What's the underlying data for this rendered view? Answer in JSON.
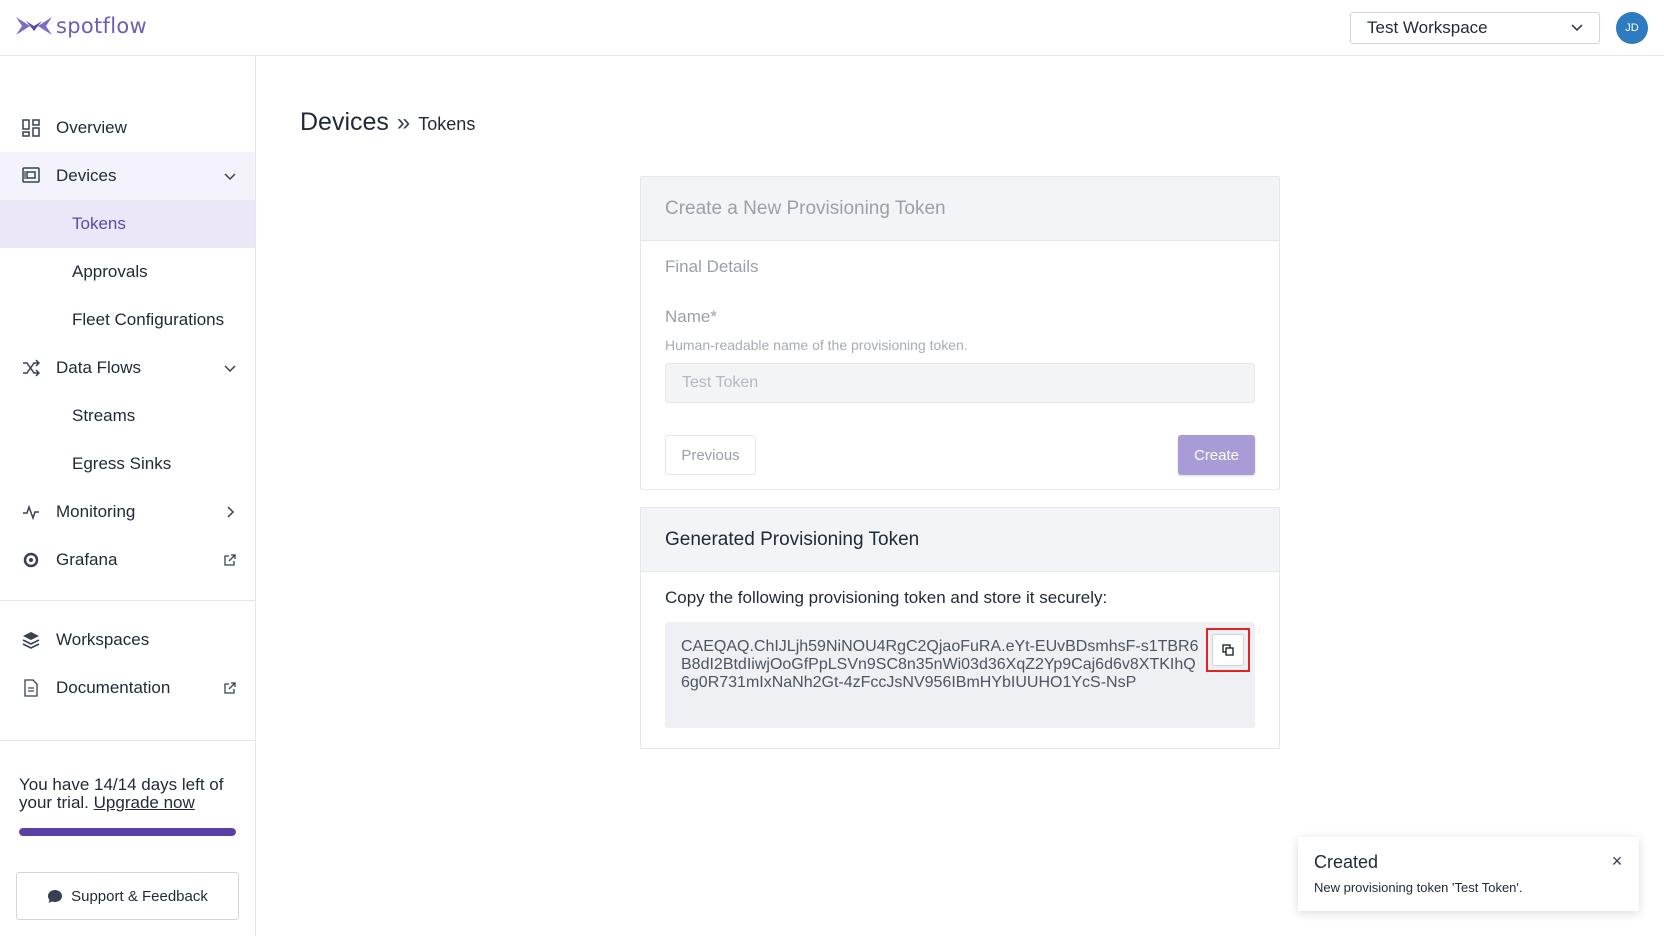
{
  "header": {
    "logo_text": "spotflow",
    "workspace": "Test Workspace",
    "avatar_initials": "JD"
  },
  "sidebar": {
    "items": [
      {
        "label": "Overview",
        "icon": "overview-icon"
      },
      {
        "label": "Devices",
        "icon": "devices-icon"
      },
      {
        "label": "Tokens"
      },
      {
        "label": "Approvals"
      },
      {
        "label": "Fleet Configurations"
      },
      {
        "label": "Data Flows",
        "icon": "shuffle-icon"
      },
      {
        "label": "Streams"
      },
      {
        "label": "Egress Sinks"
      },
      {
        "label": "Monitoring",
        "icon": "activity-icon"
      },
      {
        "label": "Grafana",
        "icon": "grafana-icon"
      },
      {
        "label": "Workspaces",
        "icon": "layers-icon"
      },
      {
        "label": "Documentation",
        "icon": "document-icon"
      }
    ],
    "trial_text": "You have 14/14 days left of your trial.",
    "upgrade_link": "Upgrade now",
    "trial_progress": 1.0,
    "support_label": "Support & Feedback"
  },
  "breadcrumb": {
    "main": "Devices",
    "separator": "»",
    "sub": "Tokens"
  },
  "create_card": {
    "title": "Create a New Provisioning Token",
    "step": "Final Details",
    "name_label": "Name*",
    "name_help": "Human-readable name of the provisioning token.",
    "name_value": "Test Token",
    "previous_label": "Previous",
    "create_label": "Create"
  },
  "token_card": {
    "title": "Generated Provisioning Token",
    "instruction": "Copy the following provisioning token and store it securely:",
    "token": "CAEQAQ.ChIJLjh59NiNOU4RgC2QjaoFuRA.eYt-EUvBDsmhsF-s1TBR6B8dI2BtdIiwjOoGfPpLSVn9SC8n35nWi03d36XqZ2Yp9Caj6d6v8XTKIhQ6g0R731mIxNaNh2Gt-4zFccJsNV956IBmHYbIUUHO1YcS-NsP"
  },
  "toast": {
    "title": "Created",
    "message": "New provisioning token 'Test Token'."
  },
  "colors": {
    "accent": "#5b4aa8",
    "create_button": "#a99cd6",
    "highlight_border": "#e02424"
  }
}
